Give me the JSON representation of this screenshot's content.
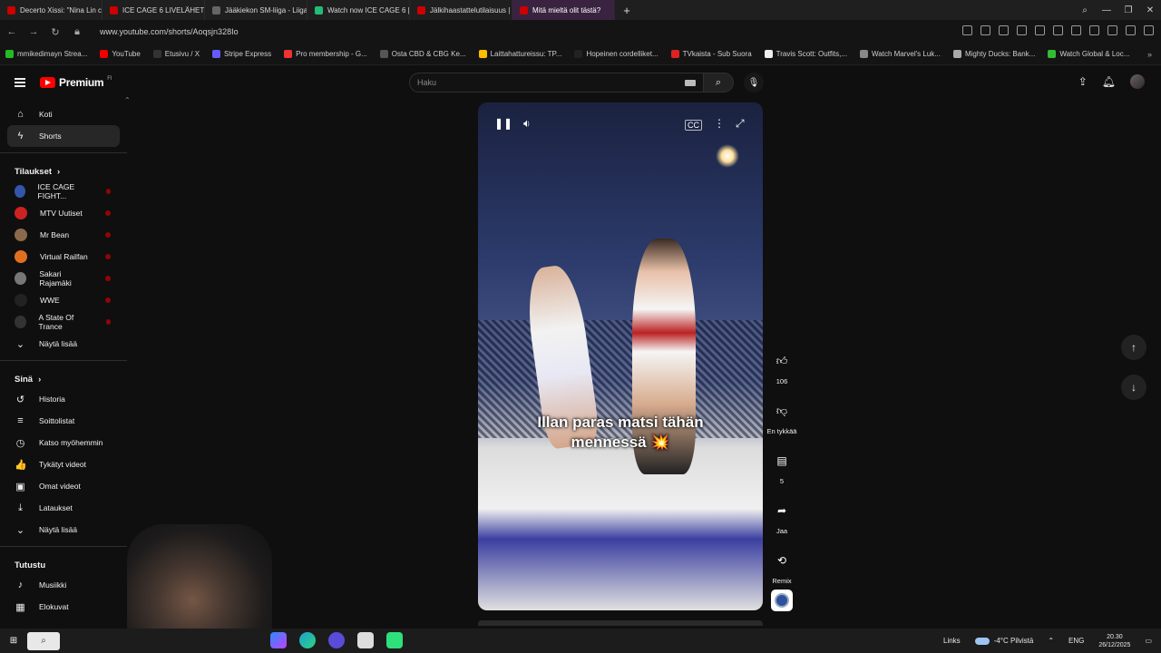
{
  "browser": {
    "tabs": [
      {
        "label": "Decerto Xissi: \"Nina Lin c",
        "color": "#c00"
      },
      {
        "label": "ICE CAGE 6 LIVELÄHETYS",
        "color": "#c00"
      },
      {
        "label": "Jääkiekon SM-liiga - Liiga",
        "color": "#666"
      },
      {
        "label": "Watch now ICE CAGE 6 |",
        "color": "#2b7"
      },
      {
        "label": "Jälkihaastattelutilaisuus |",
        "color": "#c00"
      },
      {
        "label": "Mitä mieltä olit tästä?",
        "color": "#c00"
      }
    ],
    "url": "www.youtube.com/shorts/Aoqsjn328Io",
    "bookmarks": [
      {
        "label": "mmikedimayn Strea...",
        "color": "#2b2"
      },
      {
        "label": "YouTube",
        "color": "#e00"
      },
      {
        "label": "Etusivu / X",
        "color": "#333"
      },
      {
        "label": "Stripe Express",
        "color": "#635bff"
      },
      {
        "label": "Pro membership - G...",
        "color": "#e33"
      },
      {
        "label": "Osta CBD & CBG Ke...",
        "color": "#555"
      },
      {
        "label": "Laittahattureissu: TP...",
        "color": "#fb0"
      },
      {
        "label": "Hopeinen cordelliket...",
        "color": "#222"
      },
      {
        "label": "TVkaista - Sub Suora",
        "color": "#d22"
      },
      {
        "label": "Travis Scott: Outfits,...",
        "color": "#eee"
      },
      {
        "label": "Watch Marvel's Luk...",
        "color": "#888"
      },
      {
        "label": "Mighty Ducks: Bank...",
        "color": "#aaa"
      },
      {
        "label": "Watch Global & Loc...",
        "color": "#3b3"
      }
    ]
  },
  "header": {
    "logo_text": "Premium",
    "logo_region": "FI",
    "search_placeholder": "Haku"
  },
  "sidebar": {
    "main": [
      {
        "label": "Koti",
        "icon": "home-icon",
        "glyph": "⌂"
      },
      {
        "label": "Shorts",
        "icon": "shorts-icon",
        "glyph": "ϟ"
      }
    ],
    "subs_title": "Tilaukset",
    "subs": [
      {
        "label": "ICE CAGE FIGHT...",
        "color": "#3355aa"
      },
      {
        "label": "MTV Uutiset",
        "color": "#c22"
      },
      {
        "label": "Mr Bean",
        "color": "#8a6a4a"
      },
      {
        "label": "Virtual Railfan",
        "color": "#e07020"
      },
      {
        "label": "Sakari Rajamäki",
        "color": "#777"
      },
      {
        "label": "WWE",
        "color": "#222"
      },
      {
        "label": "A State Of Trance",
        "color": "#333"
      }
    ],
    "subs_more": "Näytä lisää",
    "you_title": "Sinä",
    "you": [
      {
        "label": "Historia",
        "icon": "history-icon",
        "glyph": "↺"
      },
      {
        "label": "Soittolistat",
        "icon": "playlists-icon",
        "glyph": "≡"
      },
      {
        "label": "Katso myöhemmin",
        "icon": "watch-later-icon",
        "glyph": "◷"
      },
      {
        "label": "Tykätyt videot",
        "icon": "liked-icon",
        "glyph": "👍"
      },
      {
        "label": "Omat videot",
        "icon": "your-videos-icon",
        "glyph": "▣"
      },
      {
        "label": "Lataukset",
        "icon": "downloads-icon",
        "glyph": "⤓"
      }
    ],
    "you_more": "Näytä lisää",
    "explore_title": "Tutustu",
    "explore": [
      {
        "label": "Musiikki",
        "icon": "music-icon",
        "glyph": "♪"
      },
      {
        "label": "Elokuvat",
        "icon": "movies-icon",
        "glyph": "▦"
      }
    ]
  },
  "player": {
    "caption_line1": "Illan paras matsi tähän",
    "caption_line2": "mennessä 💥"
  },
  "actions": {
    "like_count": "106",
    "dislike_label": "En tykkää",
    "comments_count": "5",
    "share_label": "Jaa",
    "remix_label": "Remix"
  },
  "taskbar": {
    "links": "Links",
    "weather": "-4°C  Pilvistä",
    "lang": "ENG",
    "time": "20.30",
    "date": "26/12/2025"
  }
}
